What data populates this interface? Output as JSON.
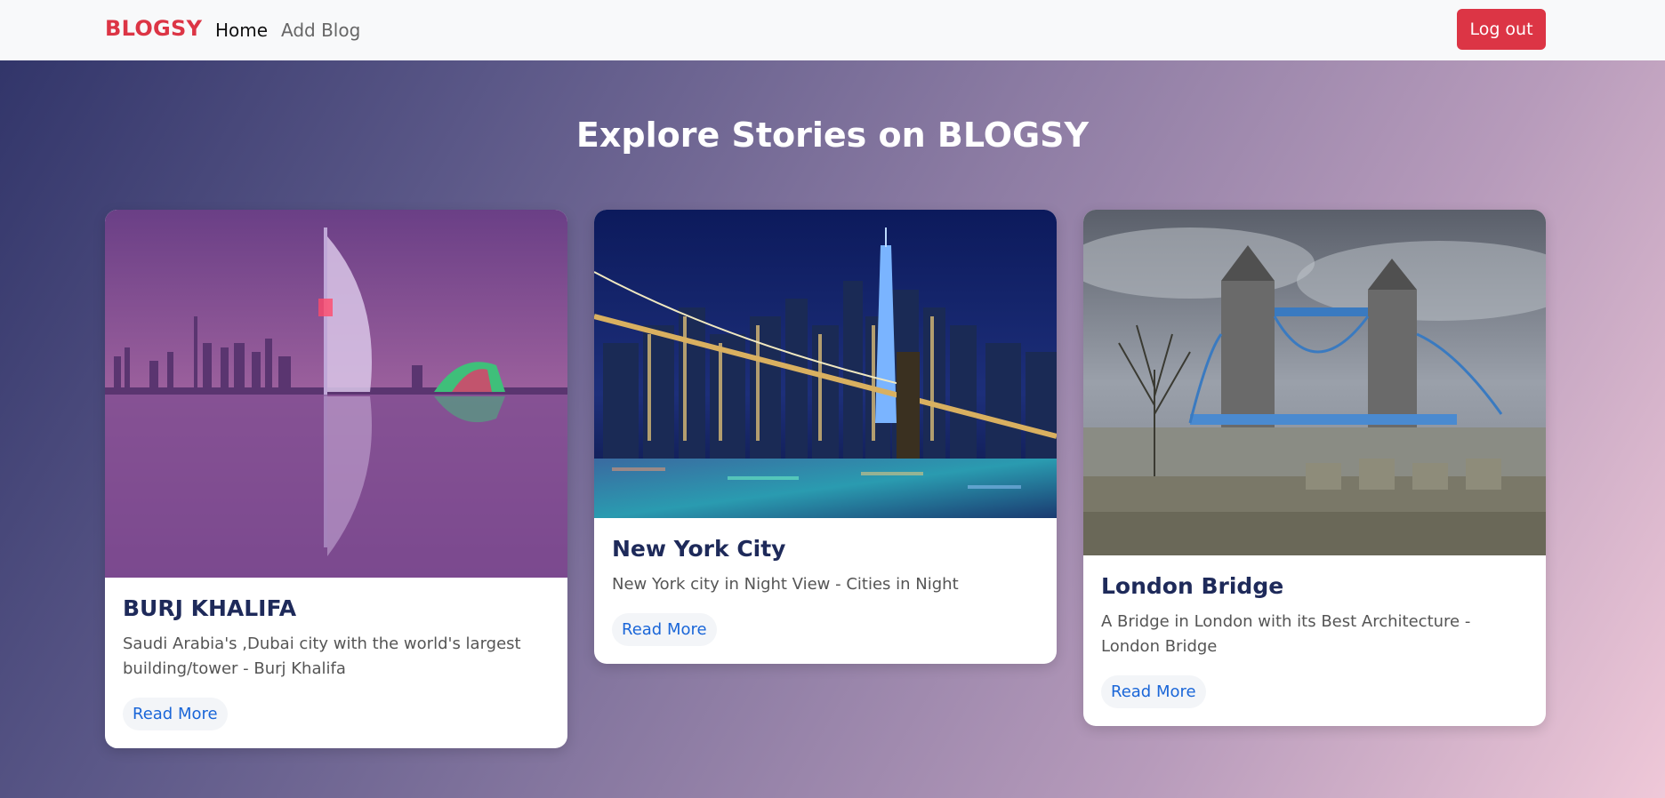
{
  "navbar": {
    "brand": "BLOGSY",
    "links": [
      {
        "label": "Home"
      },
      {
        "label": "Add Blog"
      }
    ],
    "logout_label": "Log out"
  },
  "page": {
    "title": "Explore Stories on BLOGSY"
  },
  "cards": [
    {
      "title": "BURJ KHALIFA",
      "description": "Saudi Arabia's ,Dubai city with the world's largest building/tower - Burj Khalifa",
      "read_more": "Read More"
    },
    {
      "title": "New York City",
      "description": "New York city in Night View - Cities in Night",
      "read_more": "Read More"
    },
    {
      "title": "London Bridge",
      "description": "A Bridge in London with its Best Architecture - London Bridge",
      "read_more": "Read More"
    }
  ],
  "colors": {
    "brand": "#dc3545",
    "logout": "#dc3545",
    "link": "#1a66d8",
    "title": "#1e2a5a"
  }
}
